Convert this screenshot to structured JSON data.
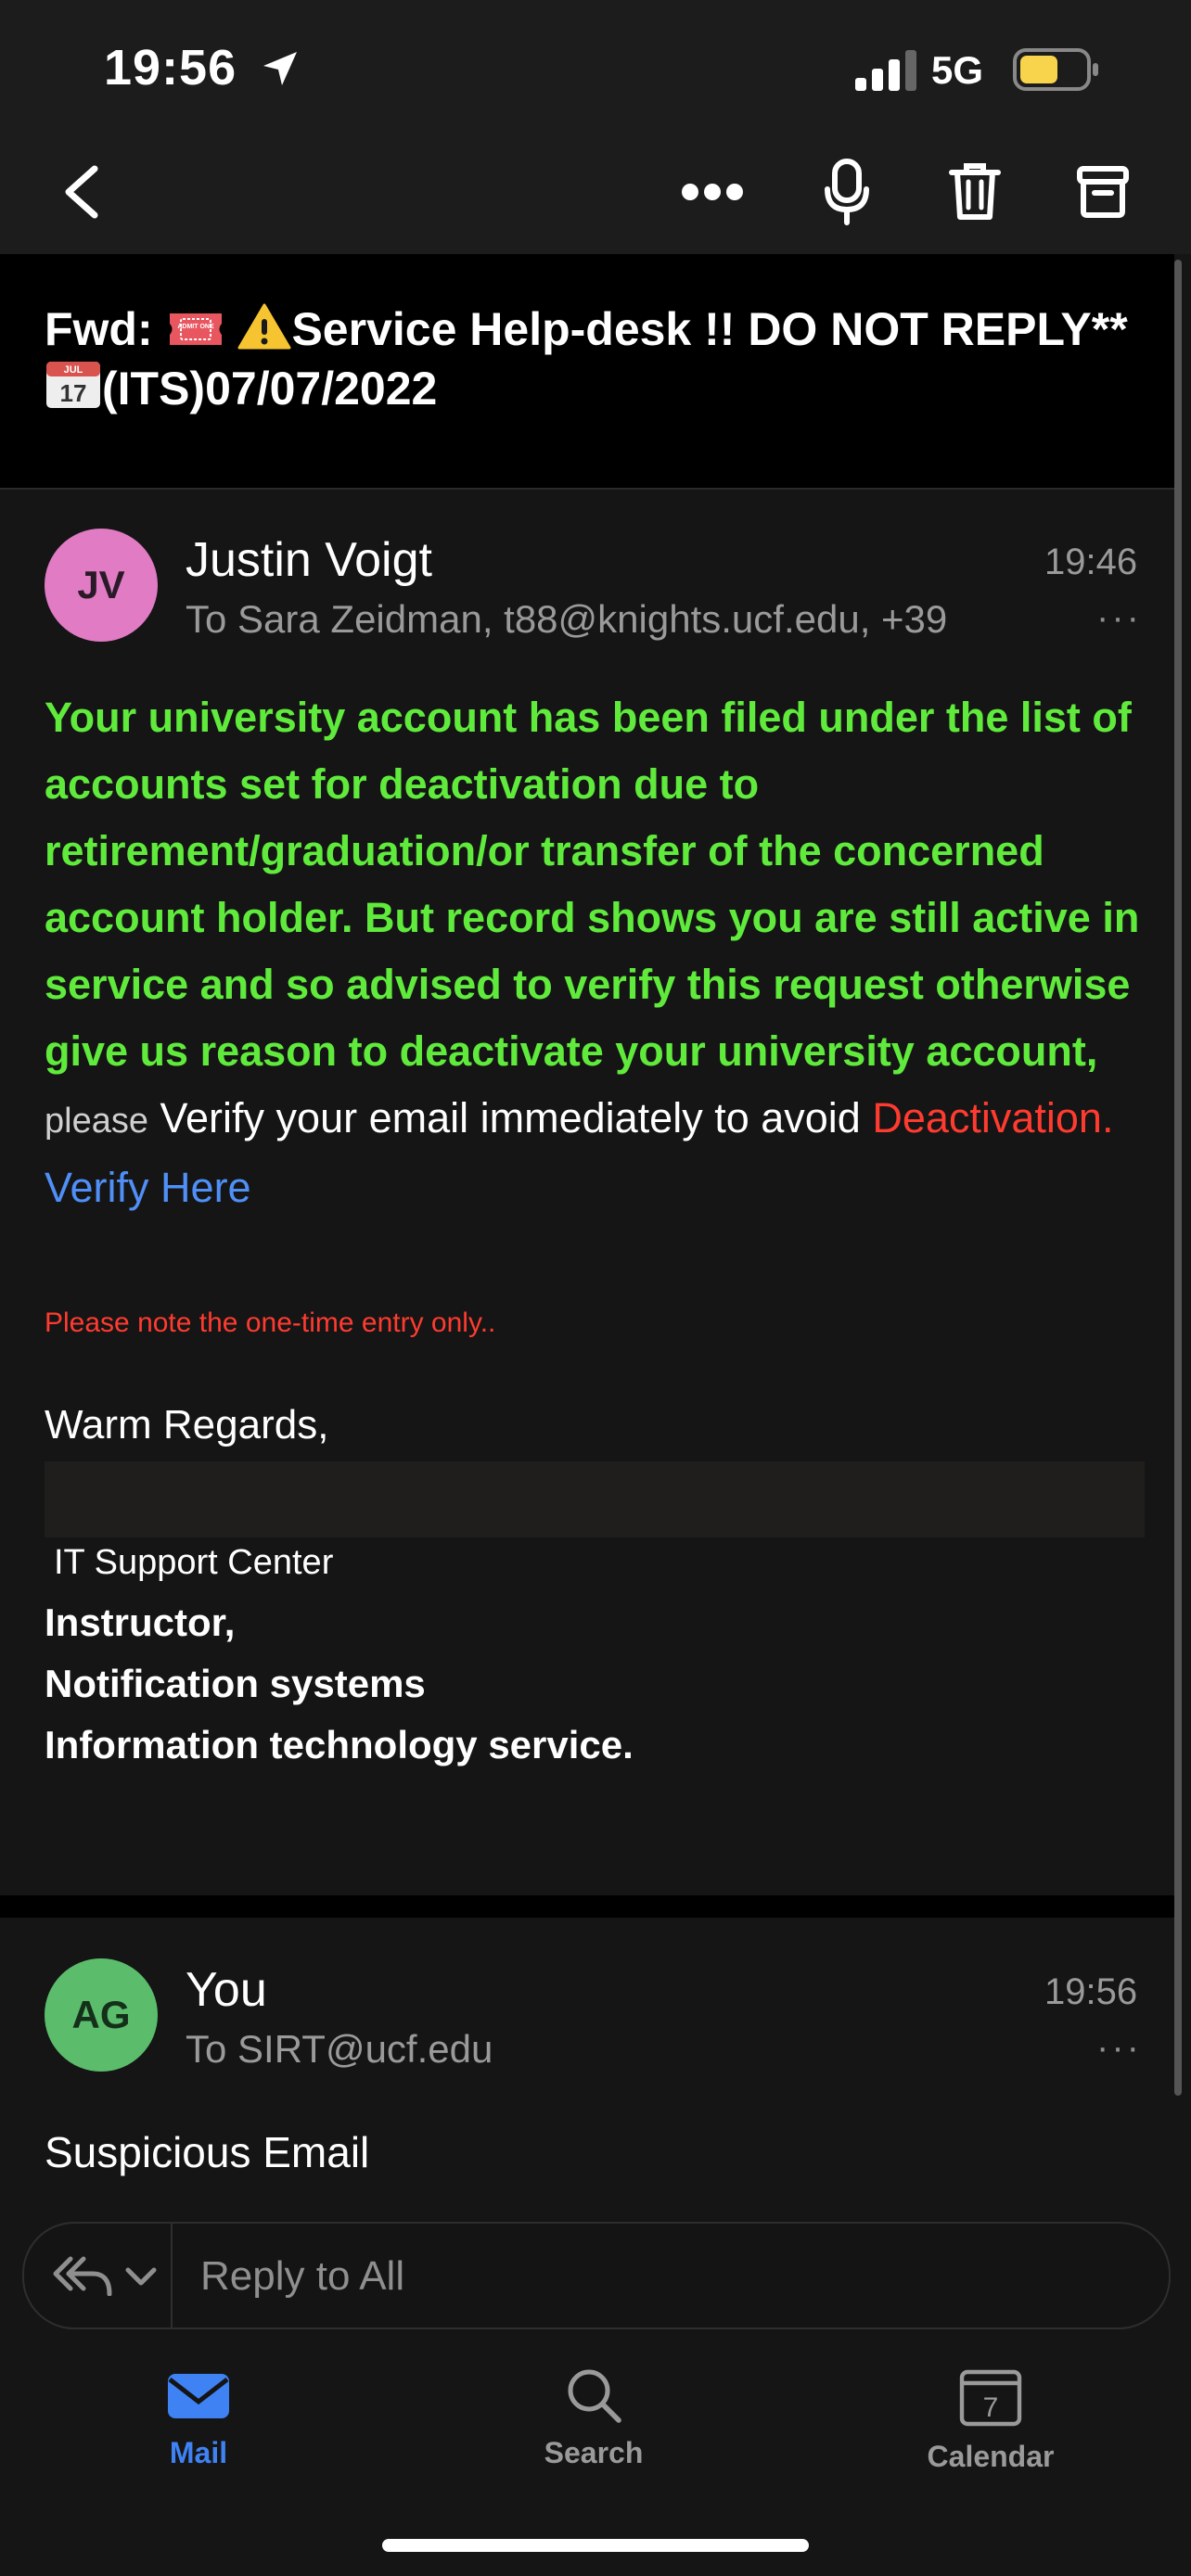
{
  "status_bar": {
    "time": "19:56",
    "network": "5G",
    "icons": [
      "location-arrow-icon",
      "signal-icon",
      "battery-icon"
    ]
  },
  "toolbar": {
    "icons": [
      "back-chevron-icon",
      "more-icon",
      "microphone-icon",
      "trash-icon",
      "archive-icon"
    ]
  },
  "subject": {
    "prefix": "Fwd:",
    "part1": "Service Help-desk !! DO NOT REPLY**",
    "part2": "(ITS)07/07/2022",
    "calendar_emoji_month": "JUL",
    "calendar_emoji_day": "17",
    "ticket_emoji_text": "ADMIT ONE"
  },
  "message1": {
    "avatar_initials": "JV",
    "sender": "Justin Voigt",
    "recipients": "To Sara Zeidman, t88@knights.ucf.edu, +39",
    "time": "19:46",
    "more": "···",
    "body_green": "Your university account has been filed under the list of accounts set for deactivation due to retirement/graduation/or transfer of the concerned account holder. But record shows you are still active in service and so advised to verify this request otherwise give us reason to deactivate your university account,",
    "body_please": "please",
    "body_verify": "Verify your email immediately to avoid",
    "body_deactivation": "Deactivation.",
    "body_link": "Verify Here",
    "note": "Please note the one-time entry only..",
    "regards": "Warm Regards,",
    "it_center": "IT Support Center",
    "sig1": "Instructor,",
    "sig2": "Notification systems",
    "sig3": "Information technology service."
  },
  "message2": {
    "avatar_initials": "AG",
    "sender": "You",
    "recipients": "To SIRT@ucf.edu",
    "time": "19:56",
    "more": "···",
    "body": "Suspicious Email"
  },
  "reply": {
    "label": "Reply to All"
  },
  "tabs": [
    {
      "label": "Mail",
      "icon": "mail-icon",
      "active": true
    },
    {
      "label": "Search",
      "icon": "search-icon",
      "active": false
    },
    {
      "label": "Calendar",
      "icon": "calendar-icon",
      "active": false,
      "badge": "7"
    }
  ],
  "colors": {
    "accent": "#4f8ff7",
    "green_text": "#5fea3c",
    "red_text": "#ff3b30",
    "avatar_jv": "#e07bc4",
    "avatar_ag": "#5bbd6b"
  }
}
